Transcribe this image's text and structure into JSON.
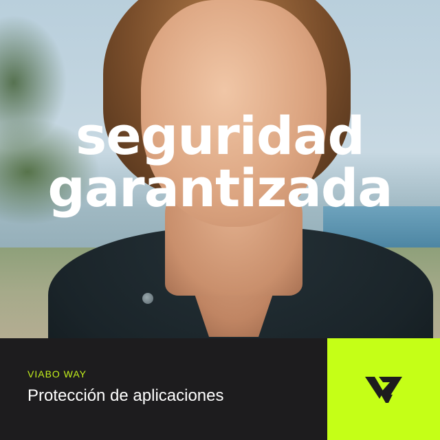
{
  "headline": {
    "line1": "seguridad",
    "line2": "garantizada"
  },
  "footer": {
    "brand_tag": "VIABO WAY",
    "subtitle": "Protección de aplicaciones"
  },
  "colors": {
    "accent": "#c5ff17",
    "brand_text": "#c5f21c",
    "bar_background": "#1d1c1e",
    "headline": "#ffffff"
  },
  "logo": {
    "icon": "viabo-logo-icon"
  }
}
